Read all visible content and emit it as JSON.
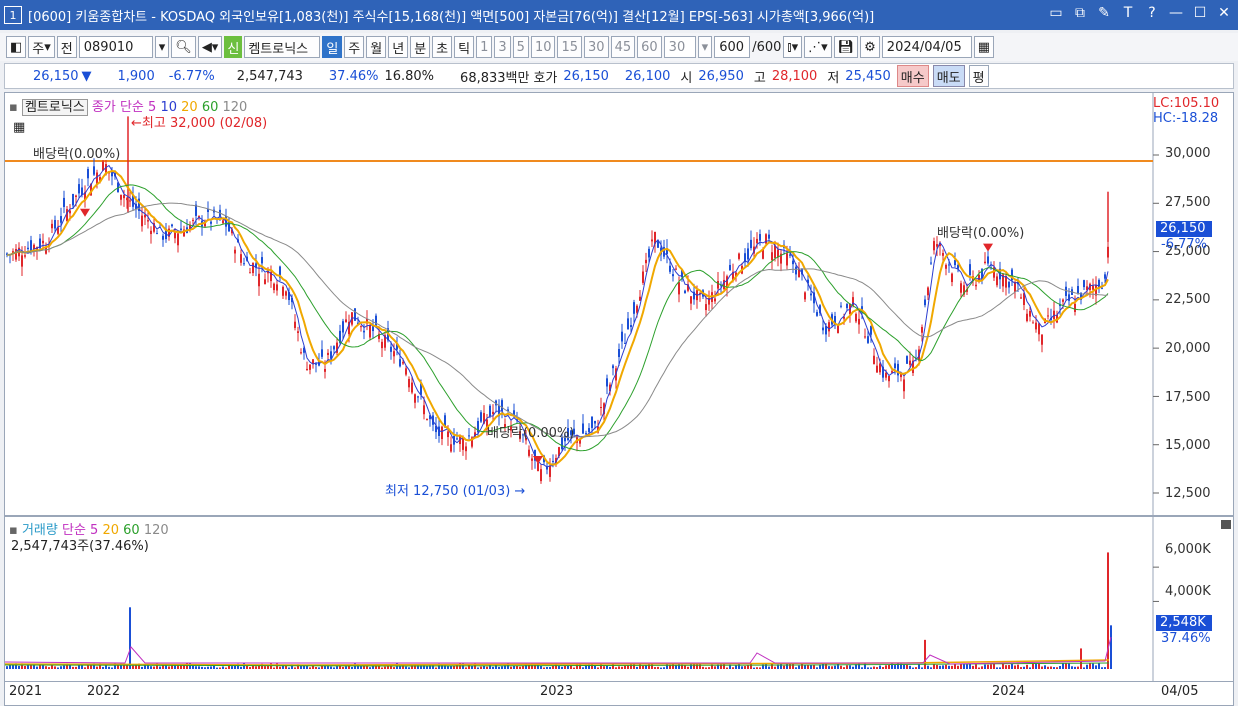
{
  "window": {
    "number": "1",
    "title": "[0600] 키움종합차트 - KOSDAQ 외국인보유[1,083(천)] 주식수[15,168(천)] 액면[500] 자본금[76(억)] 결산[12월] EPS[-563] 시가총액[3,966(억)]"
  },
  "toolbar": {
    "market": "주",
    "prev": "전",
    "code": "089010",
    "new_badge": "신",
    "stock_name": "켐트로닉스",
    "periods": [
      "일",
      "주",
      "월",
      "년",
      "분",
      "초",
      "틱"
    ],
    "selected_period": "일",
    "intervals": [
      "1",
      "3",
      "5",
      "10",
      "15",
      "30",
      "45",
      "60"
    ],
    "interval_value": "30",
    "count": "600",
    "count_total": "/600",
    "date": "2024/04/05"
  },
  "info": {
    "price": "26,150",
    "change": "1,900",
    "change_pct": "-6.77%",
    "volume": "2,547,743",
    "vol_ratio": "37.46%",
    "turnover": "16.80%",
    "amount": "68,833백만",
    "ask_label": "호가",
    "ask": "26,150",
    "bid": "26,100",
    "open_label": "시",
    "open": "26,950",
    "high_label": "고",
    "high": "28,100",
    "low_label": "저",
    "low": "25,450",
    "buy": "매수",
    "sell": "매도",
    "eval": "평"
  },
  "price_chart": {
    "name": "켐트로닉스",
    "ma_label": "종가 단순",
    "ma_periods": [
      "5",
      "10",
      "20",
      "60",
      "120"
    ],
    "lc": "LC:105.10",
    "hc": "HC:-18.28",
    "y_ticks": [
      "30,000",
      "27,500",
      "25,000",
      "22,500",
      "20,000",
      "17,500",
      "15,000",
      "12,500"
    ],
    "current_price": "26,150",
    "current_pct": "-6.77%",
    "max_note": "최고 32,000 (02/08)",
    "min_note": "최저 12,750 (01/03)",
    "dividend_notes": [
      "배당락(0.00%)",
      "배당락(0.00%)",
      "배당락(0.00%)"
    ]
  },
  "volume_chart": {
    "label": "거래량",
    "ma_label": "단순",
    "ma_periods": [
      "5",
      "20",
      "60",
      "120"
    ],
    "value_text": "2,547,743주(37.46%)",
    "y_ticks": [
      "6,000K",
      "4,000K"
    ],
    "current": "2,548K",
    "current_pct": "37.46%"
  },
  "dates": [
    "2021",
    "2022",
    "2023",
    "2024",
    "04/05"
  ],
  "colors": {
    "title_bg": "#2f63b8",
    "up": "#e0262a",
    "down": "#1a4fd6",
    "ma5": "#c030c0",
    "ma10": "#2a3cd0",
    "ma20": "#f0a800",
    "ma60": "#2ca02c",
    "ma120": "#8a8a8a"
  }
}
